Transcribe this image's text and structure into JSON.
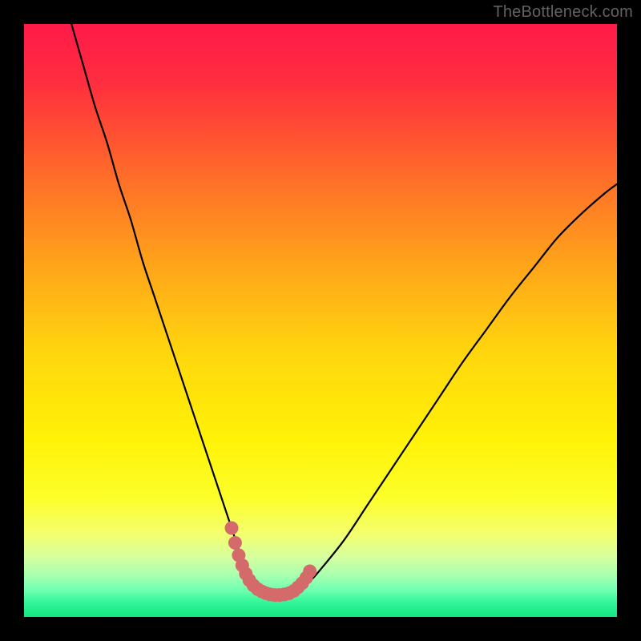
{
  "watermark": {
    "text": "TheBottleneck.com"
  },
  "gradient": {
    "stops": [
      {
        "offset": 0.0,
        "color": "#ff1a49"
      },
      {
        "offset": 0.1,
        "color": "#ff2e3e"
      },
      {
        "offset": 0.25,
        "color": "#ff6a2a"
      },
      {
        "offset": 0.4,
        "color": "#ffa21a"
      },
      {
        "offset": 0.55,
        "color": "#ffd50e"
      },
      {
        "offset": 0.7,
        "color": "#fff207"
      },
      {
        "offset": 0.8,
        "color": "#fcff2a"
      },
      {
        "offset": 0.86,
        "color": "#f4ff6e"
      },
      {
        "offset": 0.9,
        "color": "#d5ffa0"
      },
      {
        "offset": 0.93,
        "color": "#a8ffb0"
      },
      {
        "offset": 0.955,
        "color": "#6effb0"
      },
      {
        "offset": 0.975,
        "color": "#34f59a"
      },
      {
        "offset": 1.0,
        "color": "#14e77f"
      }
    ]
  },
  "chart_data": {
    "type": "line",
    "title": "",
    "xlabel": "",
    "ylabel": "",
    "xlim": [
      0,
      100
    ],
    "ylim": [
      0,
      100
    ],
    "series": [
      {
        "name": "bottleneck-curve",
        "x": [
          8,
          10,
          12,
          14,
          16,
          18,
          20,
          22,
          24,
          26,
          28,
          30,
          32,
          34,
          35,
          36,
          37,
          38,
          39,
          40,
          41,
          42,
          43,
          44,
          45,
          46,
          48,
          50,
          54,
          58,
          62,
          66,
          70,
          74,
          78,
          82,
          86,
          90,
          94,
          98,
          100
        ],
        "y": [
          100,
          93,
          86,
          80,
          73,
          67,
          60,
          54,
          48,
          42,
          36,
          30,
          24,
          18,
          15,
          12,
          9.5,
          7.5,
          6,
          5,
          4.2,
          3.8,
          3.6,
          3.6,
          3.8,
          4.3,
          5.8,
          8,
          13,
          19,
          25,
          31,
          37,
          43,
          48.5,
          54,
          59,
          64,
          68,
          71.5,
          73
        ]
      },
      {
        "name": "optimal-zone-marker",
        "x": [
          35.0,
          35.6,
          36.2,
          36.8,
          37.4,
          38.0,
          38.7,
          39.4,
          40.1,
          40.8,
          41.5,
          42.3,
          43.1,
          43.9,
          44.7,
          45.5,
          46.2,
          46.9,
          47.6,
          48.2
        ],
        "y": [
          15.0,
          12.5,
          10.4,
          8.7,
          7.3,
          6.2,
          5.3,
          4.7,
          4.3,
          4.0,
          3.8,
          3.7,
          3.7,
          3.8,
          4.0,
          4.4,
          5.0,
          5.7,
          6.6,
          7.7
        ]
      }
    ],
    "colors": {
      "bottleneck-curve": "#000000",
      "optimal-zone-marker": "#d46a6a"
    }
  }
}
